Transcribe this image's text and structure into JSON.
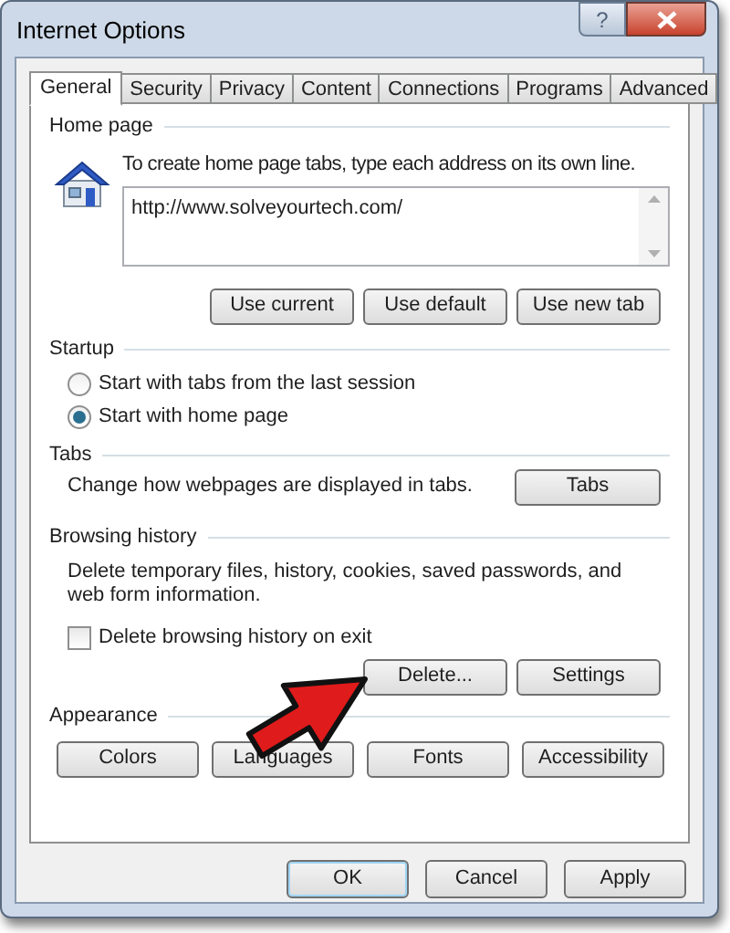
{
  "window": {
    "title": "Internet Options",
    "help": "?"
  },
  "tabs": [
    {
      "label": "General",
      "selected": true
    },
    {
      "label": "Security",
      "selected": false
    },
    {
      "label": "Privacy",
      "selected": false
    },
    {
      "label": "Content",
      "selected": false
    },
    {
      "label": "Connections",
      "selected": false
    },
    {
      "label": "Programs",
      "selected": false
    },
    {
      "label": "Advanced",
      "selected": false
    }
  ],
  "home_page": {
    "heading": "Home page",
    "description": "To create home page tabs, type each address on its own line.",
    "addresses": "http://www.solveyourtech.com/",
    "buttons": [
      "Use current",
      "Use default",
      "Use new tab"
    ]
  },
  "startup": {
    "heading": "Startup",
    "options": [
      {
        "label": "Start with tabs from the last session",
        "selected": false
      },
      {
        "label": "Start with home page",
        "selected": true
      }
    ]
  },
  "tabs_section": {
    "heading": "Tabs",
    "description": "Change how webpages are displayed in tabs.",
    "button": "Tabs"
  },
  "browsing_history": {
    "heading": "Browsing history",
    "description": "Delete temporary files, history, cookies, saved passwords, and web form information.",
    "checkbox": {
      "label": "Delete browsing history on exit",
      "checked": false
    },
    "buttons": [
      "Delete...",
      "Settings"
    ]
  },
  "appearance": {
    "heading": "Appearance",
    "buttons": [
      "Colors",
      "Languages",
      "Fonts",
      "Accessibility"
    ]
  },
  "footer_buttons": [
    {
      "label": "OK",
      "default": true
    },
    {
      "label": "Cancel",
      "default": false
    },
    {
      "label": "Apply",
      "default": false
    }
  ]
}
